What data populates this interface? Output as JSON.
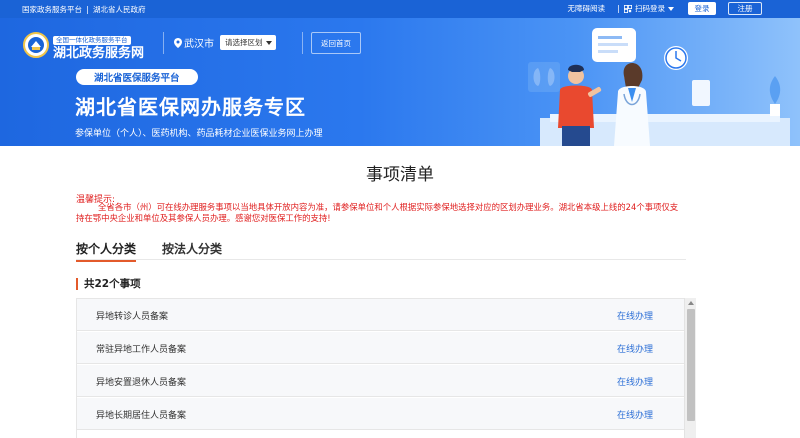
{
  "topbar": {
    "left_links": [
      "国家政务服务平台",
      "湖北省人民政府"
    ],
    "accessibility": "无障碍阅读",
    "scan_login": "扫码登录",
    "login": "登录",
    "register": "注册"
  },
  "header": {
    "logo_tag": "全国一体化政务服务平台",
    "logo_name": "湖北政务服务网",
    "city": "武汉市",
    "region_select": "请选择区划",
    "home_button": "返回首页"
  },
  "banner": {
    "badge": "湖北省医保服务平台",
    "title": "湖北省医保网办服务专区",
    "subtitle": "参保单位（个人）、医药机构、药品耗材企业医保业务网上办理"
  },
  "main": {
    "heading": "事项清单",
    "notice_title": "温馨提示:",
    "notice_body": "全省各市（州）可在线办理服务事项以当地具体开放内容为准，请参保单位和个人根据实际参保地选择对应的区划办理业务。湖北省本级上线的24个事项仅支持在鄂中央企业和单位及其参保人员办理。感谢您对医保工作的支持!",
    "tabs": [
      {
        "label": "按个人分类"
      },
      {
        "label": "按法人分类"
      }
    ],
    "count_title": "共22个事项",
    "items": [
      {
        "name": "异地转诊人员备案",
        "action": "在线办理"
      },
      {
        "name": "常驻异地工作人员备案",
        "action": "在线办理"
      },
      {
        "name": "异地安置退休人员备案",
        "action": "在线办理"
      },
      {
        "name": "异地长期居住人员备案",
        "action": "在线办理"
      }
    ]
  },
  "colors": {
    "primary": "#1a63d6",
    "notice": "#e02020",
    "accent_tab": "#e35a2b",
    "link": "#2c6fd6"
  }
}
